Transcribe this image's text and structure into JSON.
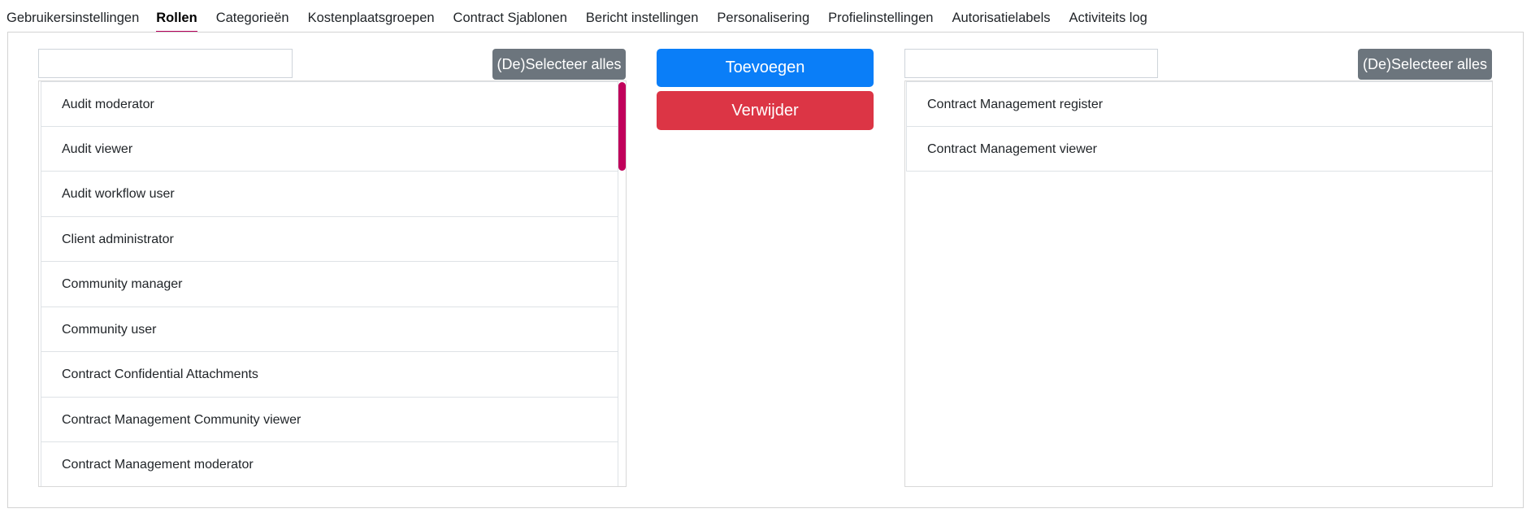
{
  "tabs": [
    {
      "label": "Gebruikersinstellingen"
    },
    {
      "label": "Rollen"
    },
    {
      "label": "Categorieën"
    },
    {
      "label": "Kostenplaatsgroepen"
    },
    {
      "label": "Contract Sjablonen"
    },
    {
      "label": "Bericht instellingen"
    },
    {
      "label": "Personalisering"
    },
    {
      "label": "Profielinstellingen"
    },
    {
      "label": "Autorisatielabels"
    },
    {
      "label": "Activiteits log"
    }
  ],
  "active_tab": "Rollen",
  "left": {
    "search_value": "",
    "select_all_label": "(De)Selecteer alles",
    "items": [
      "Audit moderator",
      "Audit viewer",
      "Audit workflow user",
      "Client administrator",
      "Community manager",
      "Community user",
      "Contract Confidential Attachments",
      "Contract Management Community viewer",
      "Contract Management moderator"
    ]
  },
  "actions": {
    "add_label": "Toevoegen",
    "remove_label": "Verwijder"
  },
  "right": {
    "search_value": "",
    "select_all_label": "(De)Selecteer alles",
    "items": [
      "Contract Management register",
      "Contract Management viewer"
    ]
  },
  "colors": {
    "active_tab_underline": "#b5005b",
    "scrollbar": "#c0005a",
    "add_button": "#0a7ef8",
    "remove_button": "#dc3545",
    "select_all_button": "#6c757d"
  }
}
